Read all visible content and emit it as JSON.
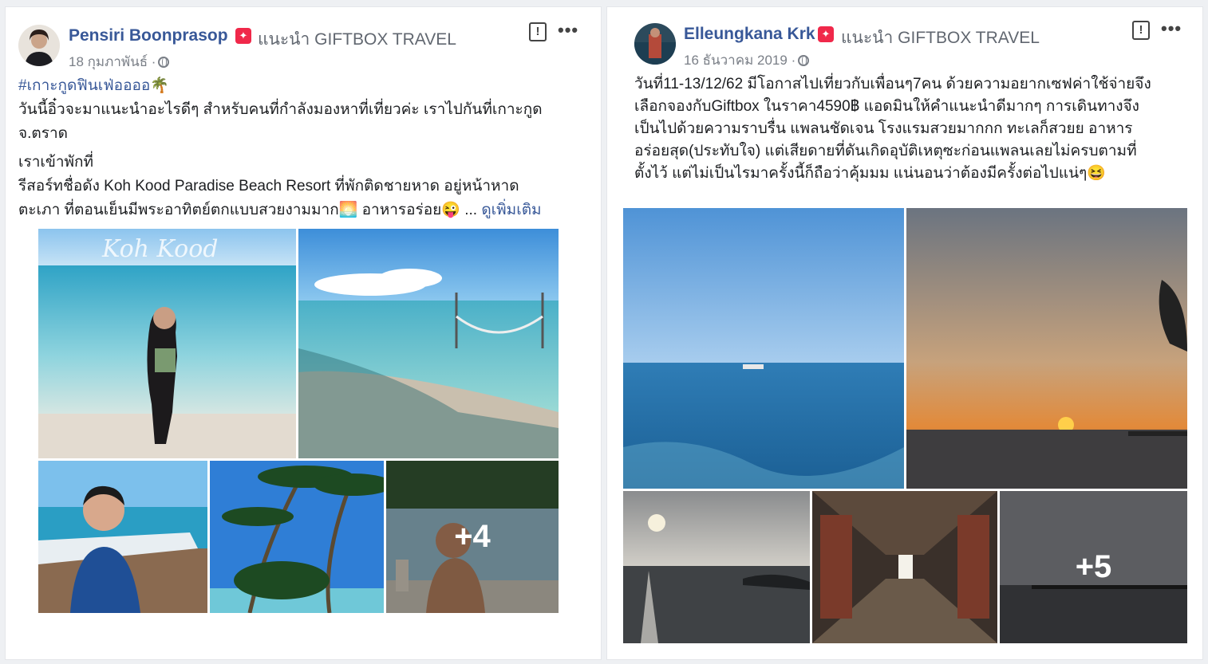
{
  "posts": [
    {
      "author": "Pensiri Boonprasop",
      "recommends": "แนะนำ GIFTBOX TRAVEL",
      "date": "18 กุมภาพันธ์ ·",
      "lines": [
        "#เกาะกูดฟินเฟ่ออออ🌴",
        "วันนี้อิ๋วจะมาแนะนำอะไรดีๆ สำหรับคนที่กำลังมองหาที่เที่ยวค่ะ เราไปกันที่เกาะกูด",
        "จ.ตราด",
        "เราเข้าพักที่",
        "รีสอร์ทชื่อดัง Koh Kood Paradise Beach Resort ที่พักติดชายหาด อยู่หน้าหาด",
        "ตะเภา ที่ตอนเย็นมีพระอาทิตย์ตกแบบสวยงามมาก🌅 อาหารอร่อย😜 ..."
      ],
      "see_more": "ดูเพิ่มเติม",
      "photo_caption": "Koh Kood",
      "more_count": "+4"
    },
    {
      "author": "Elleungkana Krk",
      "recommends": "แนะนำ GIFTBOX TRAVEL",
      "date": "16 ธันวาคม 2019 ·",
      "lines": [
        "วันที่11-13/12/62 มีโอกาสไปเที่ยวกับเพื่อนๆ7คน ด้วยความอยากเซฟค่าใช้จ่ายจึง",
        "เลือกจองกับGiftbox ในราคา4590฿ แอดมินให้คำแนะนำดีมากๆ การเดินทางจึง",
        "เป็นไปด้วยความราบรื่น แพลนชัดเจน โรงแรมสวยมากกก ทะเลก็สวยย อาหาร",
        "อร่อยสุด(ประทับใจ) แต่เสียดายที่ดันเกิดอุบัติเหตุซะก่อนแพลนเลยไม่ครบตามที่",
        "ตั้งไว้ แต่ไม่เป็นไรมาครั้งนี้ก็ถือว่าคุ้มมม แน่นอนว่าต้องมีครั้งต่อไปแน่ๆ😆"
      ],
      "more_count": "+5"
    }
  ],
  "icons": {
    "badge": "star-badge-icon",
    "report": "report-icon",
    "menu": "more-options-icon",
    "privacy": "globe-icon"
  }
}
